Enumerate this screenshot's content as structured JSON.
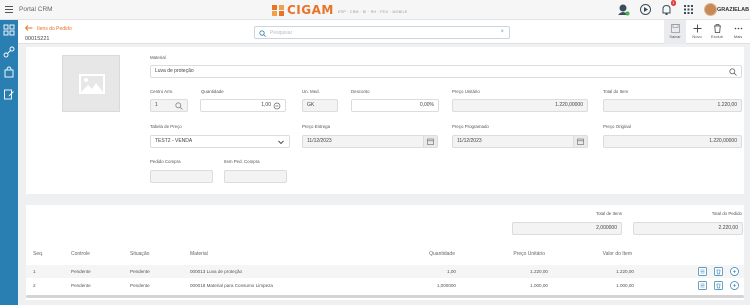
{
  "app": {
    "portal_title": "Portal CRM",
    "logo_text": "CIGAM",
    "logo_tagline": "ERP · CRM · BI · RH · PDV · MOBILE",
    "notification_count": "1",
    "user_name": "GRAZIELAB",
    "accent_color": "#e8732a",
    "rail_color": "#2a7fb2"
  },
  "header": {
    "breadcrumb": "Itens do Pedido",
    "document_number": "00015221",
    "search_placeholder": "Pesquisar",
    "actions": [
      {
        "label": "Salvar",
        "icon": "save-icon"
      },
      {
        "label": "Novo",
        "icon": "plus-icon"
      },
      {
        "label": "Excluir",
        "icon": "trash-icon"
      },
      {
        "label": "Mais",
        "icon": "more-icon"
      }
    ]
  },
  "form": {
    "material_label": "Material",
    "material_value": "Luva de proteção",
    "centro_label": "Centro Arm.",
    "centro_value": "1",
    "quantidade_label": "Quantidade",
    "quantidade_value": "1,00",
    "unmed_label": "Un. Med.",
    "unmed_value": "GK",
    "desconto_label": "Desconto",
    "desconto_value": "0,00%",
    "preco_unit_label": "Preço Unitário",
    "preco_unit_value": "1.220,00000",
    "total_item_label": "Total do Item",
    "total_item_value": "1.220,00",
    "tabela_label": "Tabela de Preço",
    "tabela_value": "TEST2 - VENDA",
    "entrega_label": "Preço Entrega",
    "entrega_value": "11/12/2023",
    "programado_label": "Preço Programado",
    "programado_value": "11/12/2023",
    "original_label": "Preço Original",
    "original_value": "1.220,00000",
    "pedido_compra_label": "Pedido Compra",
    "pedido_compra_value": "",
    "item_ped_label": "Item Ped. Compra",
    "item_ped_value": ""
  },
  "totals": {
    "total_itens_label": "Total de Itens",
    "total_itens_value": "2,000000",
    "total_pedido_label": "Total do Pedido",
    "total_pedido_value": "2.220,00"
  },
  "table": {
    "headers": [
      "Seq.",
      "Controle",
      "Situação",
      "Material",
      "Quantidade",
      "Preço Unitário",
      "Valor do Item"
    ],
    "rows": [
      [
        "1",
        "Pendente",
        "Pendente",
        "000013 Luva de proteção",
        "1,00",
        "1.220,00",
        "1.220,00"
      ],
      [
        "2",
        "Pendente",
        "Pendente",
        "000018 Material para Consumo Limpeza",
        "1,000000",
        "1.000,00",
        "1.000,00"
      ]
    ]
  }
}
